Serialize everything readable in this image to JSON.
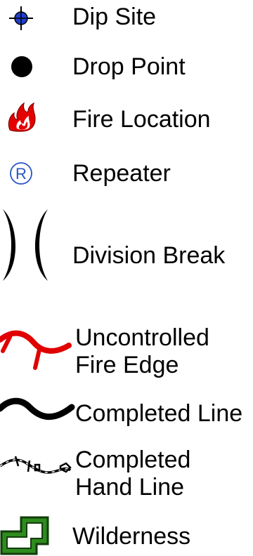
{
  "legend": {
    "items": [
      {
        "label": "Dip Site",
        "icon": "crosshair-dip-site-icon",
        "color": "#0033cc"
      },
      {
        "label": "Drop Point",
        "icon": "filled-circle-icon",
        "color": "#000000"
      },
      {
        "label": "Fire Location",
        "icon": "flame-icon",
        "color": "#e00000"
      },
      {
        "label": "Repeater",
        "icon": "circled-r-icon",
        "color": "#2255cc"
      },
      {
        "label": "Division Break",
        "icon": "division-break-icon",
        "color": "#000000"
      },
      {
        "label_lines": [
          "Uncontrolled",
          "Fire Edge"
        ],
        "icon": "uncontrolled-fire-edge-icon",
        "color": "#e00000"
      },
      {
        "label": "Completed Line",
        "icon": "completed-line-icon",
        "color": "#000000"
      },
      {
        "label_lines": [
          "Completed",
          "Hand Line"
        ],
        "icon": "completed-hand-line-icon",
        "color": "#000000"
      },
      {
        "label": "Wilderness",
        "icon": "wilderness-boundary-icon",
        "color": "#2e8b1e"
      }
    ]
  }
}
